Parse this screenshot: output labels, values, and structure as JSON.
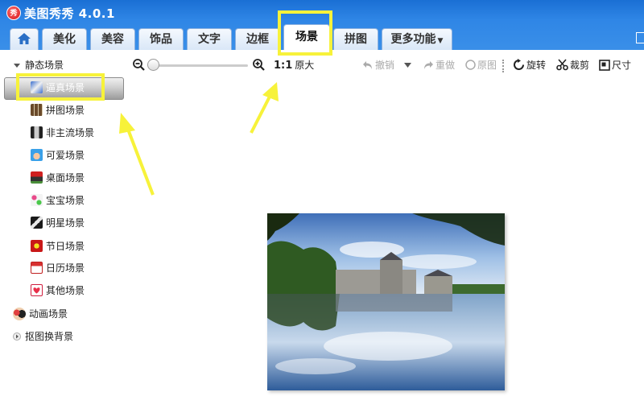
{
  "app": {
    "title": "美图秀秀 4.0.1",
    "logo_text": "秀"
  },
  "tabs": [
    {
      "label": "美化"
    },
    {
      "label": "美容"
    },
    {
      "label": "饰品"
    },
    {
      "label": "文字"
    },
    {
      "label": "边框"
    },
    {
      "label": "场景"
    },
    {
      "label": "拼图"
    },
    {
      "label": "更多功能"
    }
  ],
  "sidebar": {
    "static_group": "静态场景",
    "items": [
      {
        "label": "逼真场景"
      },
      {
        "label": "拼图场景"
      },
      {
        "label": "非主流场景"
      },
      {
        "label": "可爱场景"
      },
      {
        "label": "桌面场景"
      },
      {
        "label": "宝宝场景"
      },
      {
        "label": "明星场景"
      },
      {
        "label": "节日场景"
      },
      {
        "label": "日历场景"
      },
      {
        "label": "其他场景"
      }
    ],
    "animated_group": "动画场景",
    "cutout_group": "抠图换背景"
  },
  "toolbar": {
    "actual_size_prefix": "1:1",
    "actual_size": "原大",
    "undo": "撤销",
    "redo": "重做",
    "original": "原图",
    "rotate": "旋转",
    "crop": "裁剪",
    "resize": "尺寸"
  },
  "colors": {
    "titlebar": "#2f86e6",
    "highlight": "#f7f23a",
    "tab_border": "#8bb0de"
  }
}
